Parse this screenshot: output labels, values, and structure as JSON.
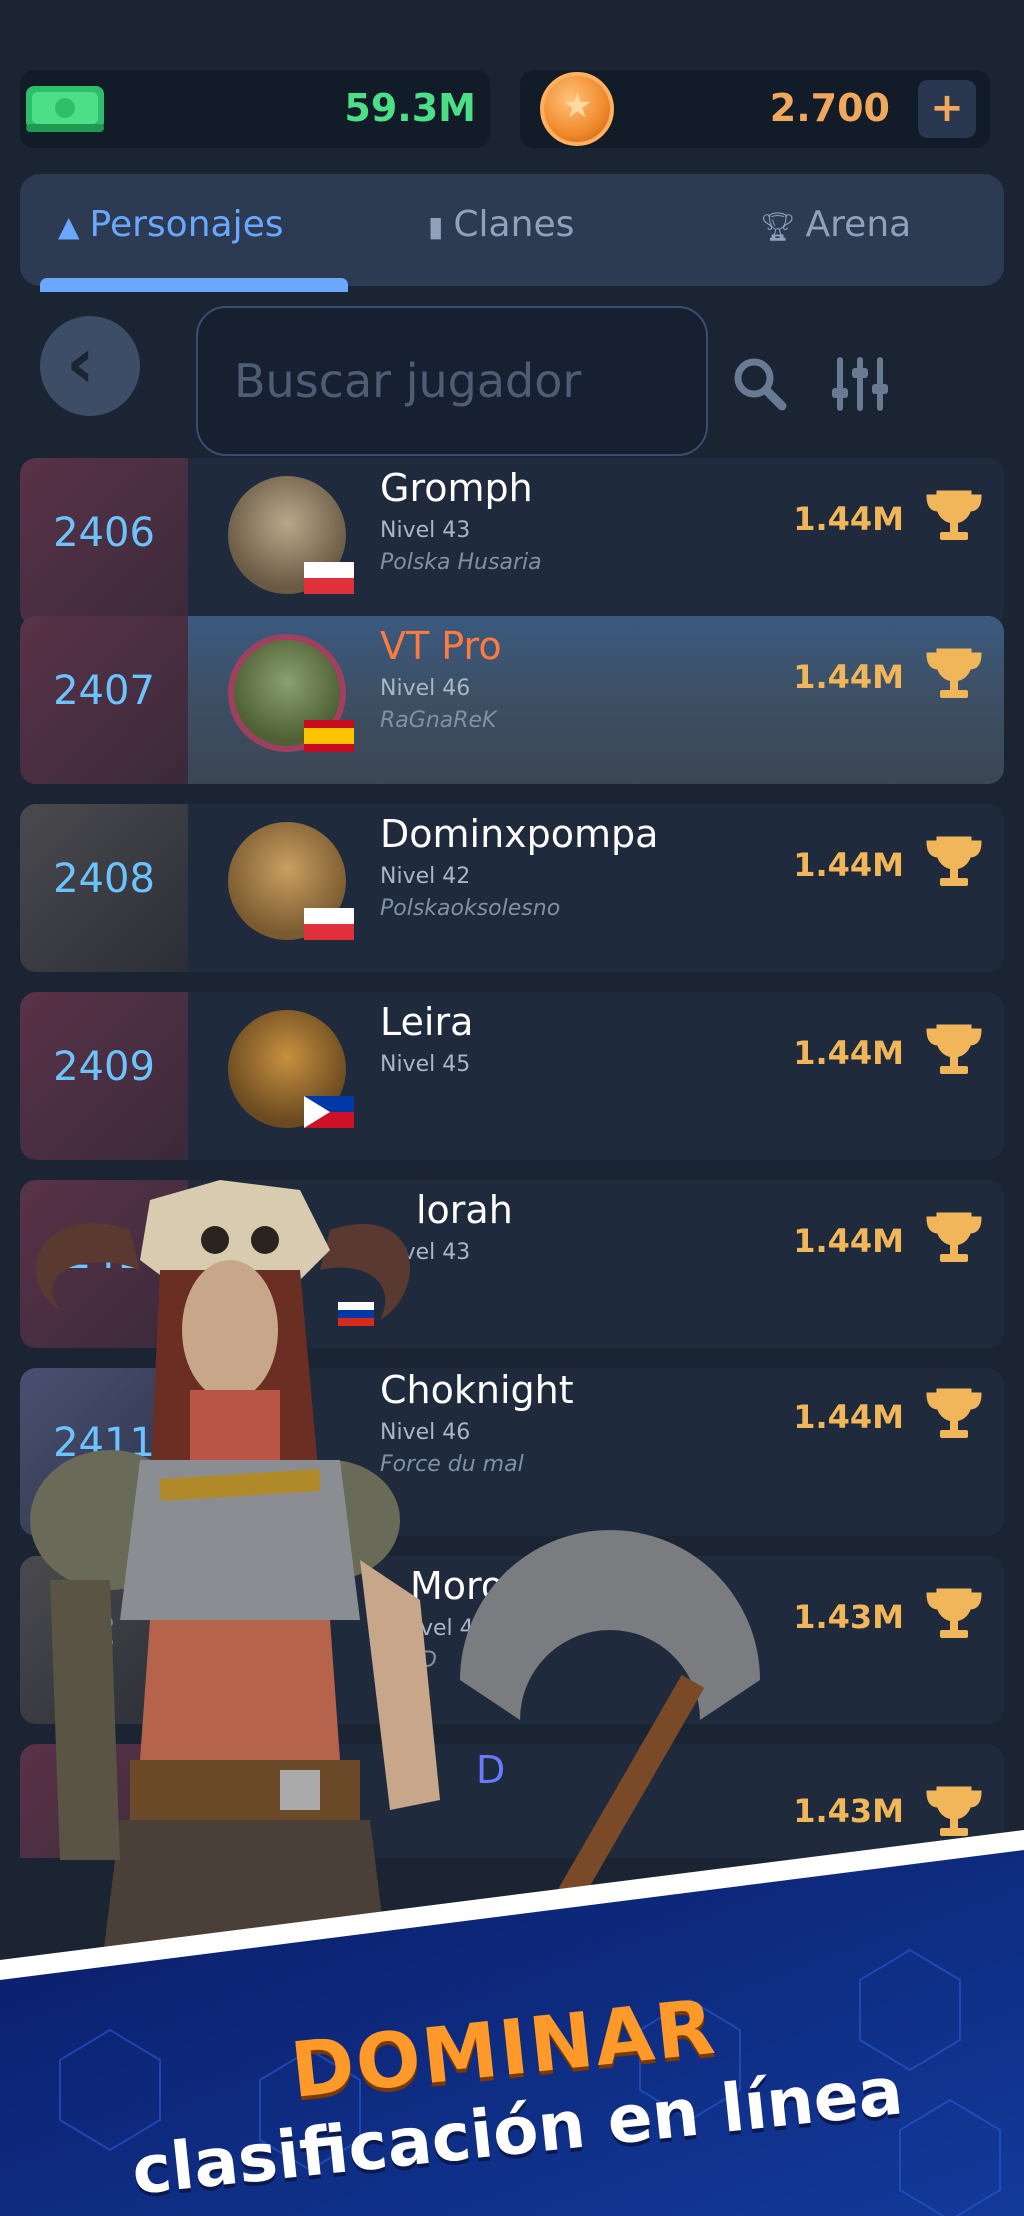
{
  "currency": {
    "cash_value": "59.3M",
    "coin_value": "2.700",
    "plus_label": "+"
  },
  "tabs": [
    {
      "label": "Personajes",
      "icon": "person-icon",
      "active": true
    },
    {
      "label": "Clanes",
      "icon": "clan-icon",
      "active": false
    },
    {
      "label": "Arena",
      "icon": "trophy-icon",
      "active": false
    }
  ],
  "search": {
    "placeholder": "Buscar jugador"
  },
  "leaderboard": [
    {
      "rank": "2406",
      "name": "Gromph",
      "level": "Nivel 43",
      "clan": "Polska Husaria",
      "flag": "pl",
      "score": "1.44M"
    },
    {
      "rank": "2407",
      "name": "VT Pro",
      "level": "Nivel 46",
      "clan": "RaGnaReK",
      "flag": "es",
      "score": "1.44M",
      "highlighted": true
    },
    {
      "rank": "2408",
      "name": "Dominxpompa",
      "level": "Nivel 42",
      "clan": "Polskaoksolesno",
      "flag": "pl",
      "score": "1.44M"
    },
    {
      "rank": "2409",
      "name": "Leira",
      "level": "Nivel 45",
      "clan": "",
      "flag": "ph",
      "score": "1.44M"
    },
    {
      "rank": "241",
      "name": "lorah",
      "level": "Nivel 43",
      "clan": "",
      "flag": "ru",
      "score": "1.44M"
    },
    {
      "rank": "2411",
      "name": "Choknight",
      "level": "Nivel 46",
      "clan": "Force du mal",
      "flag": "",
      "score": "1.44M"
    },
    {
      "rank": "2",
      "name": "Morok!",
      "level": "vel 41",
      "clan": "D",
      "flag": "",
      "score": "1.43M"
    },
    {
      "rank": "",
      "name": "D",
      "level": "",
      "clan": "",
      "flag": "",
      "score": "1.43M"
    }
  ],
  "banner": {
    "title": "DOMINAR",
    "subtitle": "clasificación en línea"
  },
  "colors": {
    "accent_blue": "#6aa8ff",
    "cash_green": "#4ddf88",
    "coin_orange": "#f0a85c",
    "highlight_name": "#ff7a40"
  }
}
